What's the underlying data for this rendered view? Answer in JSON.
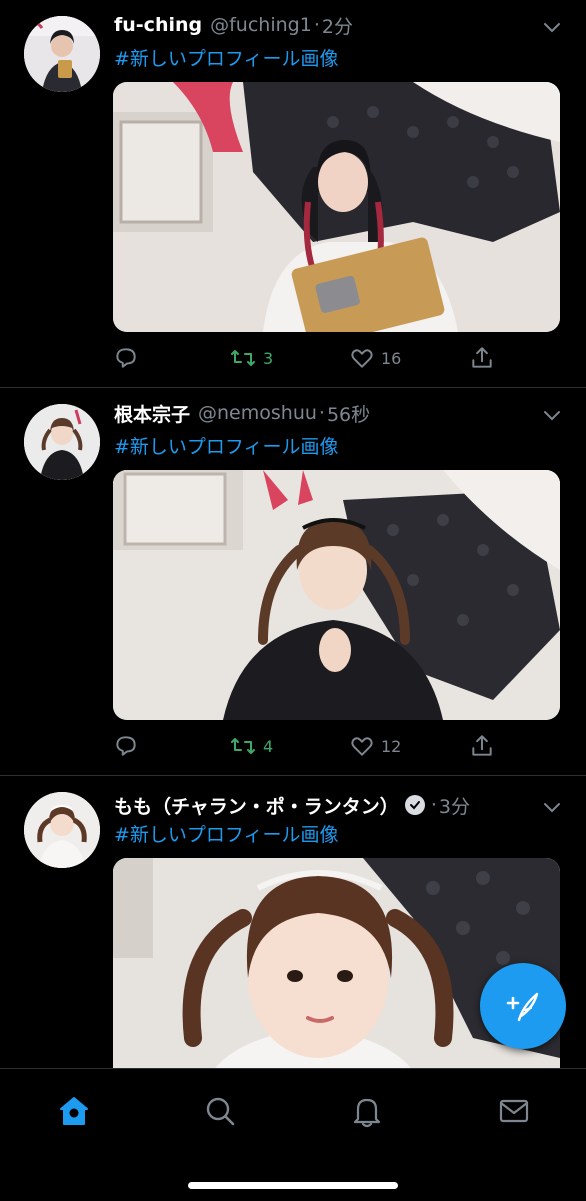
{
  "tweets": [
    {
      "name": "fu-ching",
      "handle": "@fuching1",
      "separator": "·",
      "time": "2分",
      "text": "#新しいプロフィール画像",
      "replies": "",
      "retweets": "3",
      "likes": "16",
      "verified": false
    },
    {
      "name": "根本宗子",
      "handle": "@nemoshuu",
      "separator": "·",
      "time": "56秒",
      "text": "#新しいプロフィール画像",
      "replies": "",
      "retweets": "4",
      "likes": "12",
      "verified": false
    },
    {
      "name": "もも（チャラン・ポ・ランタン）",
      "handle": "",
      "separator": "·",
      "time": "3分",
      "text": "#新しいプロフィール画像",
      "verified": true
    }
  ],
  "icons": {
    "reply": "reply-icon",
    "retweet": "retweet-icon",
    "like": "heart-icon",
    "share": "share-icon",
    "compose": "compose-icon",
    "home": "home-icon",
    "search": "search-icon",
    "notifications": "bell-icon",
    "messages": "mail-icon"
  },
  "colors": {
    "accent": "#1d9bf0",
    "retweet_active": "#3ea869",
    "muted": "#7e8790",
    "background": "#000000"
  }
}
